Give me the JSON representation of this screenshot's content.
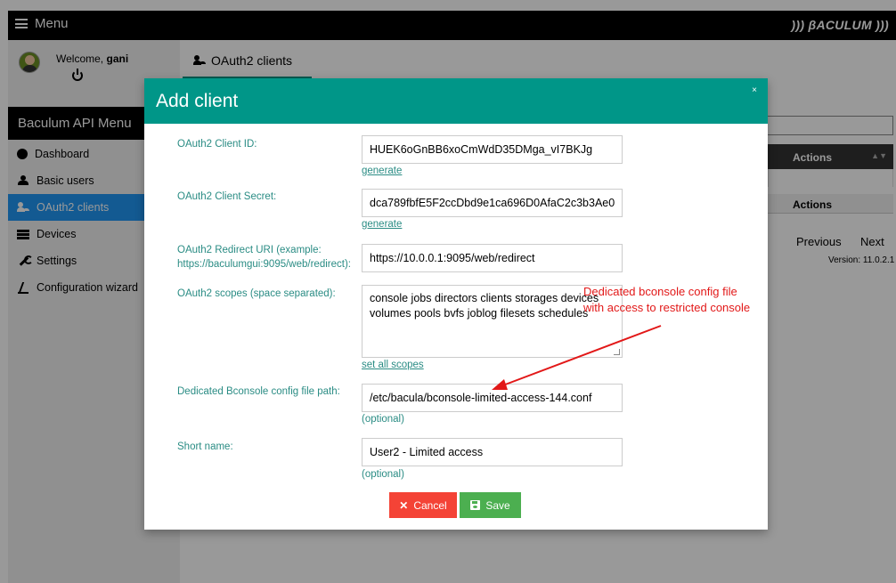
{
  "topbar": {
    "menu_label": "Menu",
    "brand": "))) βACULUM )))"
  },
  "sidebar": {
    "welcome": "Welcome,",
    "username": "gani",
    "menu_title": "Baculum API Menu",
    "items": [
      {
        "label": "Dashboard",
        "icon": "dashboard-icon",
        "active": false
      },
      {
        "label": "Basic users",
        "icon": "users-icon",
        "active": false
      },
      {
        "label": "OAuth2 clients",
        "icon": "oauth-clients-icon",
        "active": true
      },
      {
        "label": "Devices",
        "icon": "devices-icon",
        "active": false
      },
      {
        "label": "Settings",
        "icon": "wrench-icon",
        "active": false
      },
      {
        "label": "Configuration wizard",
        "icon": "wizard-icon",
        "active": false
      }
    ]
  },
  "main": {
    "title": "OAuth2 clients",
    "table_header_actions": "Actions",
    "table_footer_actions": "Actions",
    "pagination_previous": "Previous",
    "pagination_next": "Next",
    "version": "Version: 11.0.2.1"
  },
  "modal": {
    "title": "Add client",
    "close": "×",
    "client_id_label": "OAuth2 Client ID:",
    "client_id_value": "HUEK6oGnBB6xoCmWdD35DMga_vI7BKJg",
    "client_id_generate": "generate",
    "client_secret_label": "OAuth2 Client Secret:",
    "client_secret_value": "dca789fbfE5F2ccDbd9e1ca696D0AfaC2c3b3Ae0",
    "client_secret_generate": "generate",
    "redirect_label_1": "OAuth2 Redirect URI (example:",
    "redirect_label_2": "https://baculumgui:9095/web/redirect):",
    "redirect_value": "https://10.0.0.1:9095/web/redirect",
    "scopes_label": "OAuth2 scopes (space separated):",
    "scopes_line_1": "console jobs directors clients storages devices",
    "scopes_line_2": "volumes pools bvfs joblog filesets schedules",
    "scopes_set_all": "set all scopes",
    "bconsole_label": "Dedicated Bconsole config file path:",
    "bconsole_value": "/etc/bacula/bconsole-limited-access-144.conf",
    "bconsole_hint": "(optional)",
    "short_name_label": "Short name:",
    "short_name_value": "User2 - Limited access",
    "short_name_hint": "(optional)",
    "cancel_label": "Cancel",
    "save_label": "Save"
  },
  "annotation": {
    "line_1": "Dedicated bconsole config file",
    "line_2": "with access to restricted console",
    "color": "#e21818"
  },
  "colors": {
    "accent": "#009688",
    "active_nav": "#2196f3",
    "cancel": "#f44336",
    "save": "#4caf50"
  }
}
